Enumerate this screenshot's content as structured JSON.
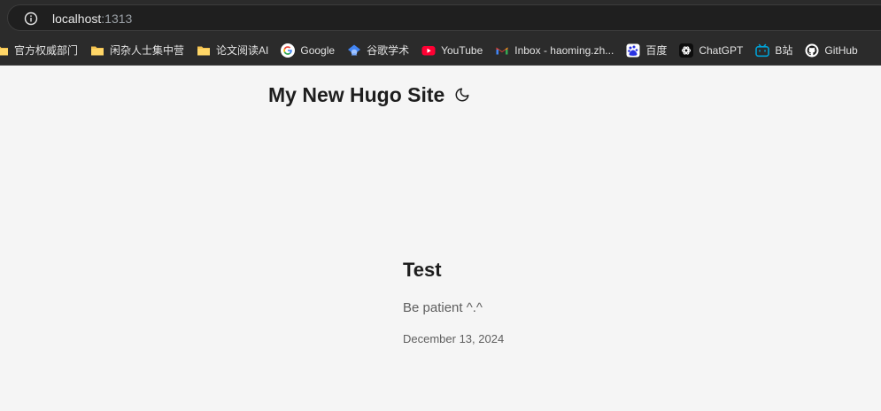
{
  "browser": {
    "url_host": "localhost",
    "url_port": ":1313",
    "bookmarks": [
      {
        "label": "官方权威部门",
        "icon": "folder-icon"
      },
      {
        "label": "闲杂人士集中营",
        "icon": "folder-icon"
      },
      {
        "label": "论文阅读AI",
        "icon": "folder-icon"
      },
      {
        "label": "Google",
        "icon": "google-icon"
      },
      {
        "label": "谷歌学术",
        "icon": "scholar-icon"
      },
      {
        "label": "YouTube",
        "icon": "youtube-icon"
      },
      {
        "label": "Inbox - haoming.zh...",
        "icon": "gmail-icon"
      },
      {
        "label": "百度",
        "icon": "baidu-icon"
      },
      {
        "label": "ChatGPT",
        "icon": "chatgpt-icon"
      },
      {
        "label": "B站",
        "icon": "bilibili-icon"
      },
      {
        "label": "GitHub",
        "icon": "github-icon"
      }
    ]
  },
  "site": {
    "title": "My New Hugo Site",
    "theme_toggle_icon": "moon-icon"
  },
  "post": {
    "title": "Test",
    "summary": "Be patient ^.^",
    "date": "December 13, 2024"
  },
  "colors": {
    "chrome_bg": "#2b2b2b",
    "page_bg": "#f5f5f5",
    "text_dark": "#1e1e1e",
    "text_muted": "#5f5f5f"
  }
}
